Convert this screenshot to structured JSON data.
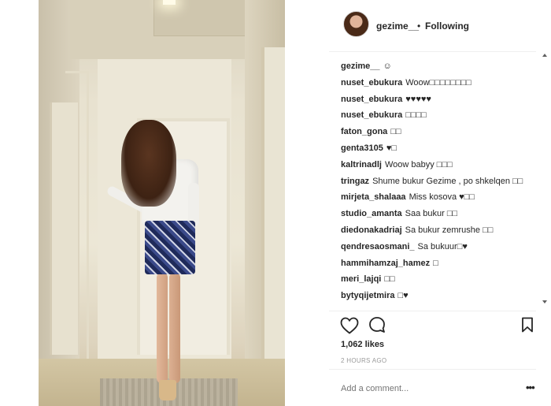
{
  "post": {
    "photo_alt": "gezime__ post"
  },
  "header": {
    "username": "gezime__",
    "separator": "•",
    "follow_state": "Following"
  },
  "comments": [
    {
      "user": "gezime__",
      "text": "☺"
    },
    {
      "user": "nuset_ebukura",
      "text": "Woow□□□□□□□□"
    },
    {
      "user": "nuset_ebukura",
      "text": "♥♥♥♥♥"
    },
    {
      "user": "nuset_ebukura",
      "text": "□□□□"
    },
    {
      "user": "faton_gona",
      "text": "□□"
    },
    {
      "user": "genta3105",
      "text": "♥□"
    },
    {
      "user": "kaltrinadlj",
      "text": "Woow babyy □□□"
    },
    {
      "user": "tringaz",
      "text": "Shume bukur Gezime , po shkelqen □□"
    },
    {
      "user": "mirjeta_shalaaa",
      "text": "Miss kosova ♥□□"
    },
    {
      "user": "studio_amanta",
      "text": "Saa bukur □□"
    },
    {
      "user": "diedonakadriaj",
      "text": "Sa bukur zemrushe □□"
    },
    {
      "user": "qendresaosmani_",
      "text": "Sa bukuur□♥"
    },
    {
      "user": "hammihamzaj_hamez",
      "text": "□"
    },
    {
      "user": "meri_lajqi",
      "text": "□□"
    },
    {
      "user": "bytyqijetmira",
      "text": "□♥"
    }
  ],
  "footer": {
    "likes": "1,062 likes",
    "time": "2 HOURS AGO",
    "add_comment_placeholder": "Add a comment...",
    "more_label": "•••"
  },
  "icons": {
    "like": "heart-icon",
    "comment": "comment-icon",
    "save": "bookmark-icon",
    "more": "more-options-icon"
  }
}
